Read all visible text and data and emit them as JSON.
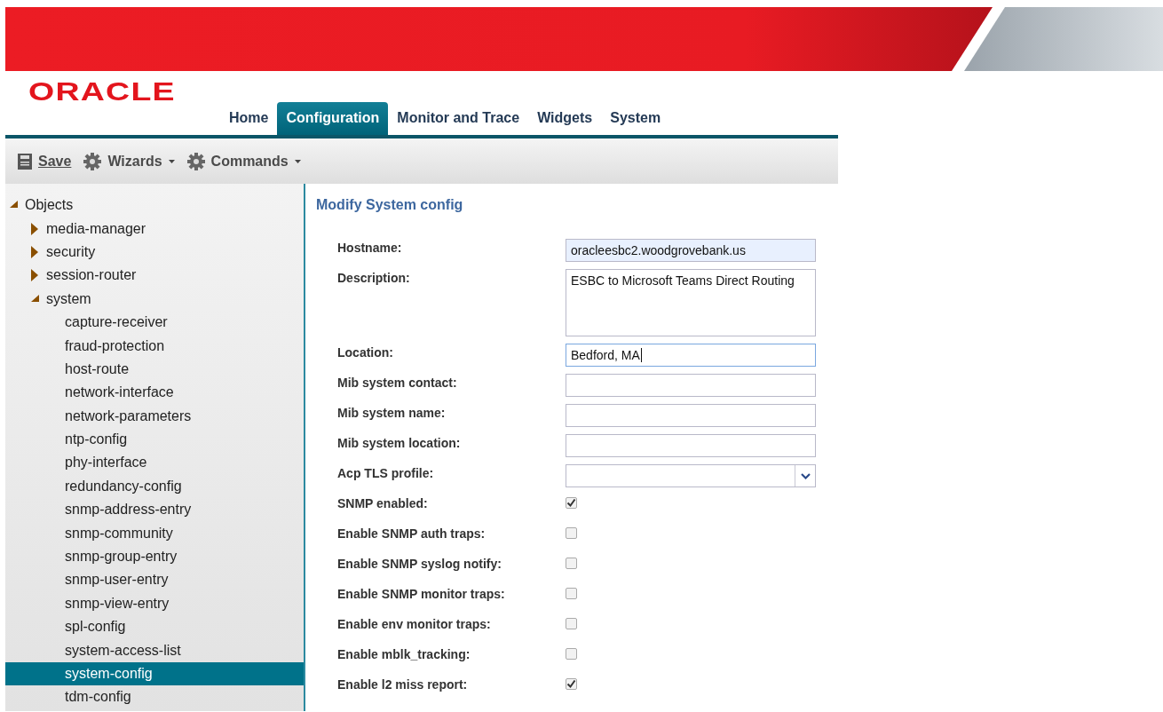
{
  "logo": "ORACLE",
  "nav_tabs": [
    {
      "label": "Home",
      "selected": false
    },
    {
      "label": "Configuration",
      "selected": true
    },
    {
      "label": "Monitor and Trace",
      "selected": false
    },
    {
      "label": "Widgets",
      "selected": false
    },
    {
      "label": "System",
      "selected": false
    }
  ],
  "toolbar": [
    {
      "kind": "save",
      "label": "Save",
      "dropdown": false
    },
    {
      "kind": "gear",
      "label": "Wizards",
      "dropdown": true
    },
    {
      "kind": "gear",
      "label": "Commands",
      "dropdown": true
    }
  ],
  "tree": [
    {
      "label": "Objects",
      "expanded": true,
      "selected": false,
      "children": [
        {
          "label": "media-manager",
          "expanded": false,
          "selected": false
        },
        {
          "label": "security",
          "expanded": false,
          "selected": false
        },
        {
          "label": "session-router",
          "expanded": false,
          "selected": false
        },
        {
          "label": "system",
          "expanded": true,
          "selected": false,
          "children": [
            {
              "label": "capture-receiver",
              "selected": false
            },
            {
              "label": "fraud-protection",
              "selected": false
            },
            {
              "label": "host-route",
              "selected": false
            },
            {
              "label": "network-interface",
              "selected": false
            },
            {
              "label": "network-parameters",
              "selected": false
            },
            {
              "label": "ntp-config",
              "selected": false
            },
            {
              "label": "phy-interface",
              "selected": false
            },
            {
              "label": "redundancy-config",
              "selected": false
            },
            {
              "label": "snmp-address-entry",
              "selected": false
            },
            {
              "label": "snmp-community",
              "selected": false
            },
            {
              "label": "snmp-group-entry",
              "selected": false
            },
            {
              "label": "snmp-user-entry",
              "selected": false
            },
            {
              "label": "snmp-view-entry",
              "selected": false
            },
            {
              "label": "spl-config",
              "selected": false
            },
            {
              "label": "system-access-list",
              "selected": false
            },
            {
              "label": "system-config",
              "selected": true
            },
            {
              "label": "tdm-config",
              "selected": false
            }
          ]
        }
      ]
    }
  ],
  "form": {
    "title": "Modify System config",
    "fields": [
      {
        "kind": "text",
        "label": "Hostname:",
        "value": "oracleesbc2.woodgrovebank.us",
        "focused": false,
        "highlighted": true
      },
      {
        "kind": "textarea",
        "label": "Description:",
        "value": "ESBC to Microsoft Teams Direct Routing",
        "focused": false,
        "highlighted": false
      },
      {
        "kind": "text",
        "label": "Location:",
        "value": "Bedford, MA",
        "focused": true,
        "highlighted": false
      },
      {
        "kind": "text",
        "label": "Mib system contact:",
        "focused": false,
        "highlighted": false
      },
      {
        "kind": "text",
        "label": "Mib system name:",
        "focused": false,
        "highlighted": false
      },
      {
        "kind": "text",
        "label": "Mib system location:",
        "focused": false,
        "highlighted": false
      },
      {
        "kind": "select",
        "label": "Acp TLS profile:",
        "focused": false,
        "highlighted": false
      },
      {
        "kind": "checkbox",
        "label": "SNMP enabled:",
        "checked": true
      },
      {
        "kind": "checkbox",
        "label": "Enable SNMP auth traps:",
        "checked": false
      },
      {
        "kind": "checkbox",
        "label": "Enable SNMP syslog notify:",
        "checked": false
      },
      {
        "kind": "checkbox",
        "label": "Enable SNMP monitor traps:",
        "checked": false
      },
      {
        "kind": "checkbox",
        "label": "Enable env monitor traps:",
        "checked": false
      },
      {
        "kind": "checkbox",
        "label": "Enable mblk_tracking:",
        "checked": false
      },
      {
        "kind": "checkbox",
        "label": "Enable l2 miss report:",
        "checked": true
      }
    ]
  }
}
